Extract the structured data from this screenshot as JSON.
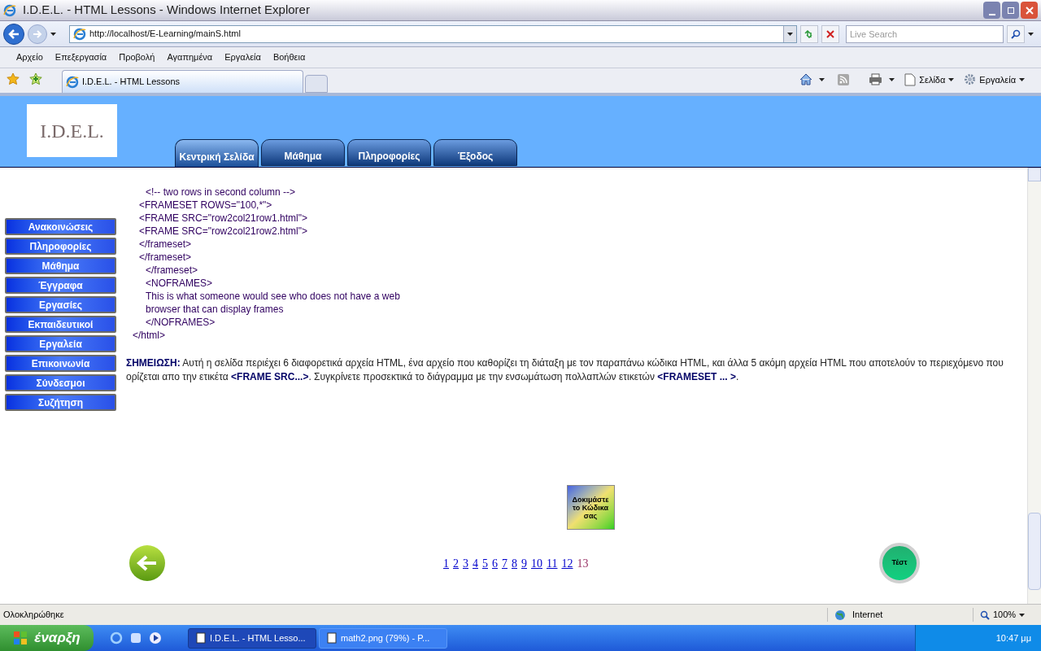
{
  "window": {
    "title": "I.D.E.L. - HTML Lessons - Windows Internet Explorer"
  },
  "address_bar": {
    "url": "http://localhost/E-Learning/mainS.html",
    "search_placeholder": "Live Search"
  },
  "menu": [
    "Αρχείο",
    "Επεξεργασία",
    "Προβολή",
    "Αγαπημένα",
    "Εργαλεία",
    "Βοήθεια"
  ],
  "browser_tabs": [
    {
      "label": "I.D.E.L. - HTML Lessons",
      "selected": true
    }
  ],
  "command_bar": {
    "page": "Σελίδα",
    "tools": "Εργαλεία"
  },
  "site": {
    "logo": "I.D.E.L.",
    "nav_tabs": [
      {
        "label": "Κεντρική Σελίδα",
        "selected": true
      },
      {
        "label": "Μάθημα",
        "selected": false
      },
      {
        "label": "Πληροφορίες",
        "selected": false
      },
      {
        "label": "Έξοδος",
        "selected": false
      }
    ],
    "sidebar": [
      "Ανακοινώσεις",
      "Πληροφορίες",
      "Μάθημα",
      "Έγγραφα",
      "Εργασίες",
      "Εκπαιδευτικοί",
      "Εργαλεία",
      "Επικοινωνία",
      "Σύνδεσμοι",
      "Συζήτηση"
    ],
    "code_lines": [
      {
        "text": "<!-- two rows in second column -->",
        "kind": "deep"
      },
      {
        "text": "<FRAMESET ROWS=\"100,*\">",
        "kind": "mid"
      },
      {
        "text": "<FRAME SRC=\"row2col21row1.html\">",
        "kind": "mid"
      },
      {
        "text": "<FRAME SRC=\"row2col21row2.html\">",
        "kind": "mid"
      },
      {
        "text": "</frameset>",
        "kind": "mid"
      },
      {
        "text": "</frameset>",
        "kind": "mid"
      },
      {
        "text": "</frameset>",
        "kind": "deep"
      },
      {
        "text": "<NOFRAMES>",
        "kind": "deep"
      },
      {
        "text": "This is what someone would see who does not have a web",
        "kind": "deep"
      },
      {
        "text": "browser that can display frames",
        "kind": "deep"
      },
      {
        "text": "</NOFRAMES>",
        "kind": "deep"
      },
      {
        "text": "</html>",
        "kind": "root"
      }
    ],
    "note": "**ΣΗΜΕΙΩΣΗ:** Αυτή η σελίδα περιέχει 6 διαφορετικά αρχεία HTML, ένα αρχείο που καθορίζει τη διάταξη με τον παραπάνω κώδικα HTML, και άλλα 5 ακόμη αρχεία HTML που αποτελούν το περιεχόμενο που ορίζεται απο την ετικέτα **<FRAME SRC...>**. Συγκρίνετε προσεκτικά το διάγραμμα με την ενσωμάτωση πολλαπλών ετικετών **<FRAMESET ... >**.",
    "try_code_button": "Δοκιμάστε το Κώδικα σας",
    "pages": [
      {
        "label": "1",
        "selected": false
      },
      {
        "label": "2",
        "selected": false
      },
      {
        "label": "3",
        "selected": false
      },
      {
        "label": "4",
        "selected": false
      },
      {
        "label": "5",
        "selected": false
      },
      {
        "label": "6",
        "selected": false
      },
      {
        "label": "7",
        "selected": false
      },
      {
        "label": "8",
        "selected": false
      },
      {
        "label": "9",
        "selected": false
      },
      {
        "label": "10",
        "selected": false
      },
      {
        "label": "11",
        "selected": false
      },
      {
        "label": "12",
        "selected": false
      },
      {
        "label": "13",
        "selected": true
      }
    ],
    "test_button": "Τέστ"
  },
  "status_bar": {
    "text": "Ολοκληρώθηκε",
    "zone": "Internet",
    "zoom": "100%"
  },
  "taskbar": {
    "start": "έναρξη",
    "tasks": [
      {
        "label": "I.D.E.L. - HTML Lesso...",
        "selected": true
      },
      {
        "label": "math2.png (79%) - P...",
        "selected": false
      }
    ],
    "clock": "10:47 μμ"
  }
}
